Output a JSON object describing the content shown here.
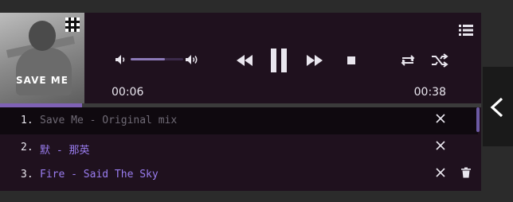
{
  "colors": {
    "panel_bg": "#1f111e",
    "page_bg": "#2b2b2b",
    "accent": "#7f62b5",
    "track_title_active": "#6f6a75",
    "track_title_purple": "#9a7df0",
    "icon": "#e9e6ee"
  },
  "album": {
    "cover_text": "SAVE ME"
  },
  "player": {
    "time_elapsed": "00:06",
    "time_total": "00:38",
    "progress_fraction": 0.17,
    "volume_fraction": 0.65
  },
  "icons": {
    "volume_low": "volume-low-icon",
    "volume_high": "volume-high-icon",
    "previous": "rewind-icon",
    "pause": "pause-icon",
    "next": "fast-forward-icon",
    "stop": "stop-icon",
    "repeat": "repeat-icon",
    "shuffle": "shuffle-icon",
    "playlist": "playlist-icon",
    "remove": "close-icon",
    "delete": "trash-icon",
    "side_toggle": "chevron-left-icon"
  },
  "playlist": {
    "items": [
      {
        "num": "1.",
        "title": "Save Me - Original mix"
      },
      {
        "num": "2.",
        "title": "默 - 那英"
      },
      {
        "num": "3.",
        "title": "Fire - Said The Sky"
      }
    ]
  }
}
